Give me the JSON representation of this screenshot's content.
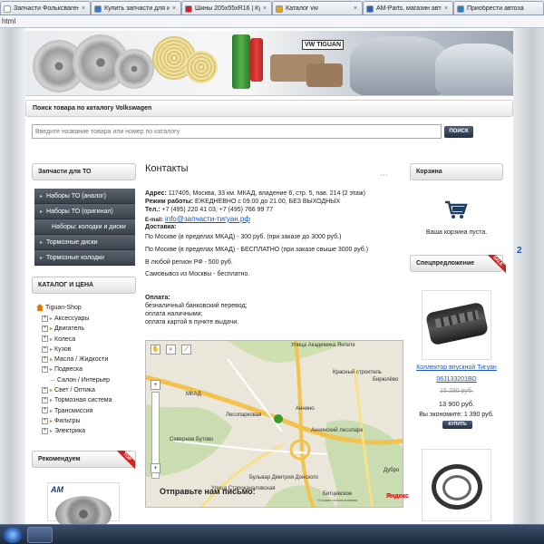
{
  "browser": {
    "tabs": [
      {
        "label": "Запчасти Фольксваген",
        "color": "#ffffff"
      },
      {
        "label": "Купить запчасти для ин",
        "color": "#3c78c8"
      },
      {
        "label": "Шины 205x55xR16 | Ку",
        "color": "#d02030"
      },
      {
        "label": "Каталог vw",
        "color": "#e0a020"
      },
      {
        "label": "AM-Parts, магазин авто",
        "color": "#3060b0"
      },
      {
        "label": "Приобрести автоза",
        "color": "#2a80c0"
      }
    ],
    "url": "html"
  },
  "banner": {
    "plate": "VW TIGUAN"
  },
  "search": {
    "title": "Поиск товара по каталогу Volkswagen",
    "placeholder": "Введите название товара или номер по каталогу",
    "button": "ПОИСК"
  },
  "left": {
    "to_title": "Запчасти для ТО",
    "to_items": [
      "Наборы ТО (аналог)",
      "Наборы ТО (оригинал)",
      "Наборы: колодки и диски",
      "Тормозные диски",
      "Тормозные колодки"
    ],
    "catalog_title": "КАТАЛОГ И ЦЕНА",
    "catalog_root": "Tiguan-Shop",
    "catalog_items": [
      "Аксессуары",
      "Двигатель",
      "Колеса",
      "Кузов",
      "Масла / Жидкости",
      "Подвеска",
      "Салон / Интерьер",
      "Свет / Оптика",
      "Тормозная система",
      "Трансмиссия",
      "Фильтры",
      "Электрика"
    ],
    "recommend_title": "Рекомендуем",
    "recommend_ribbon": "TOP",
    "recommend_logo": "AM"
  },
  "content": {
    "title": "Контакты",
    "address_label": "Адрес:",
    "address": "117405, Москва, 33 км. МКАД, владение 6, стр. 5, пав. 214 (2 этаж)",
    "hours_label": "Режим работы:",
    "hours": "ЕЖЕДНЕВНО с 09.00 до 21.00, БЕЗ ВЫХОДНЫХ",
    "phone_label": "Тел.:",
    "phone": "+7 (495) 220 41 03,  +7 (495) 766 99 77",
    "email_label": "E-mail:",
    "email": "info@запчасти-тигуан.рф",
    "delivery_label": "Доставка:",
    "delivery": [
      "По Москве (в пределах МКАД) - 300 руб. (при заказе до 3000 руб.)",
      "По Москве (в пределах МКАД) - БЕСПЛАТНО (при заказе свыше 3000 руб.)",
      "В любой регион РФ - 500 руб.",
      "Самовывоз из Москвы - бесплатно."
    ],
    "payment_label": "Оплата:",
    "payment": [
      "безналичный банковский перевод;",
      "оплата наличными;",
      "оплата картой в пункте выдачи."
    ],
    "send_title": "Отправьте нам письмо:"
  },
  "map": {
    "labels": [
      "Улица Академика Янгеля",
      "МКАД",
      "Лесопарковая",
      "Аннино",
      "Северное Бутово",
      "Бирюлёво",
      "Красный строитель",
      "Аннинский лесопарк",
      "Бульвар Дмитрия Донского",
      "Улица Старокачаловская",
      "Битцевское",
      "Дубро",
      "Бирюлёвский",
      "Ботанический сад ВИЛАР",
      "Кулаковск",
      "Варшавское шоссе",
      "Вырубово"
    ],
    "brand": "Яндекс",
    "terms": "Условия использования"
  },
  "right": {
    "cart_title": "Корзина",
    "cart_empty": "Ваша корзина пуста.",
    "special_title": "Спецпредложение",
    "special_ribbon": "SALE",
    "product_name_1": "Коллектор впускной Тигуан",
    "product_name_2": "06J133201BD",
    "old_price": "15 290 руб.",
    "price": "13 900 руб.",
    "save_text": "Вы экономите: 1 390 руб.",
    "buy": "КУПИТЬ"
  },
  "side": {
    "car_text": "2"
  }
}
